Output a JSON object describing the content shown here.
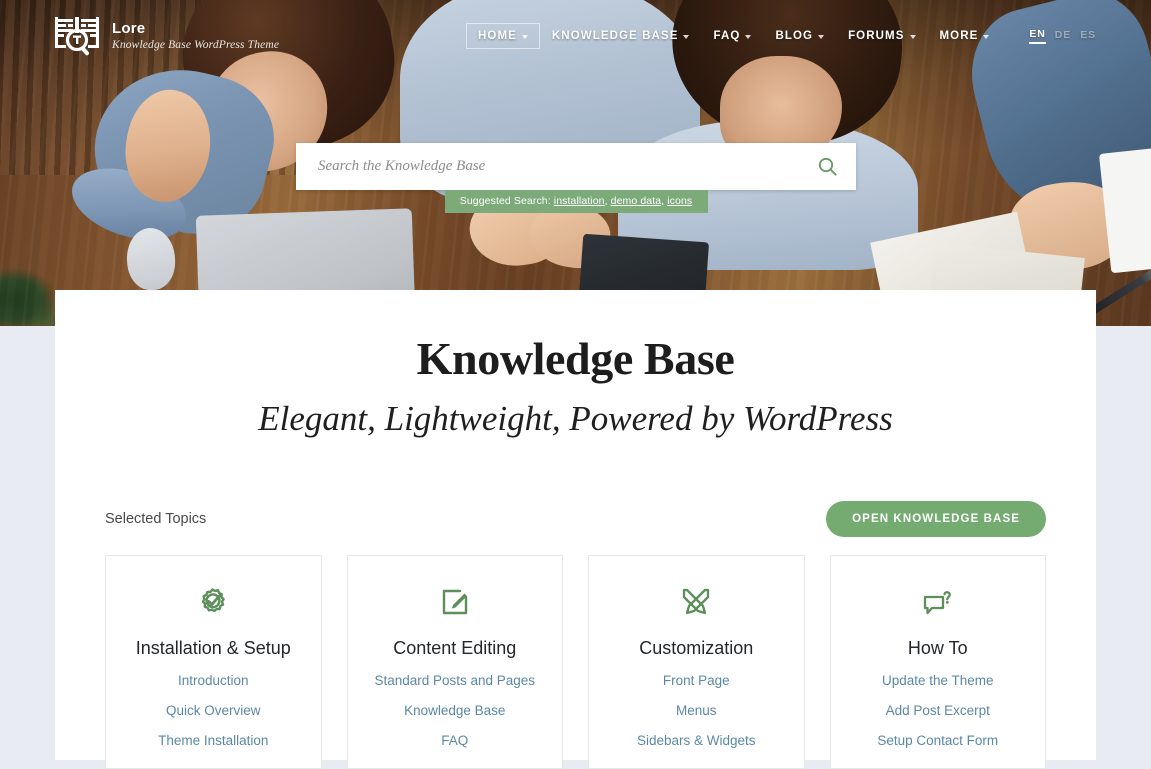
{
  "brand": {
    "name": "Lore",
    "tagline": "Knowledge Base WordPress Theme",
    "logo_icon": "book-magnifier-icon"
  },
  "nav": {
    "items": [
      {
        "label": "HOME",
        "active": true,
        "has_caret": true
      },
      {
        "label": "KNOWLEDGE BASE",
        "active": false,
        "has_caret": true
      },
      {
        "label": "FAQ",
        "active": false,
        "has_caret": true
      },
      {
        "label": "BLOG",
        "active": false,
        "has_caret": true
      },
      {
        "label": "FORUMS",
        "active": false,
        "has_caret": true
      },
      {
        "label": "MORE",
        "active": false,
        "has_caret": true
      }
    ],
    "languages": [
      {
        "label": "EN",
        "active": true
      },
      {
        "label": "DE",
        "active": false
      },
      {
        "label": "ES",
        "active": false
      }
    ]
  },
  "search": {
    "placeholder": "Search the Knowledge Base",
    "value": "",
    "icon": "search-icon",
    "suggested_label": "Suggested Search:",
    "suggestions": [
      "installation",
      "demo data",
      "icons"
    ],
    "suggest_bg": "#7cab79"
  },
  "hero": {
    "title": "Knowledge Base",
    "subtitle": "Elegant, Lightweight, Powered by WordPress"
  },
  "topics": {
    "label": "Selected Topics",
    "button_label": "OPEN KNOWLEDGE BASE",
    "button_color": "#74ab71",
    "cards": [
      {
        "icon": "gear-check-icon",
        "title": "Installation & Setup",
        "links": [
          "Introduction",
          "Quick Overview",
          "Theme Installation"
        ]
      },
      {
        "icon": "edit-square-pencil-icon",
        "title": "Content Editing",
        "links": [
          "Standard Posts and Pages",
          "Knowledge Base",
          "FAQ"
        ]
      },
      {
        "icon": "brush-pencil-cross-icon",
        "title": "Customization",
        "links": [
          "Front Page",
          "Menus",
          "Sidebars & Widgets"
        ]
      },
      {
        "icon": "speech-bubble-question-icon",
        "title": "How To",
        "links": [
          "Update the Theme",
          "Add Post Excerpt",
          "Setup Contact Form"
        ]
      }
    ]
  },
  "colors": {
    "accent_green": "#74ab71",
    "link_blue": "#5b88a5",
    "page_bg": "#e8ebf1"
  }
}
